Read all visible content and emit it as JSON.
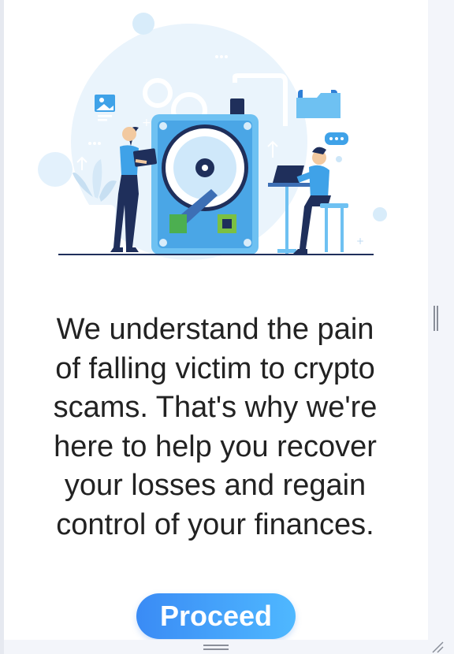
{
  "illustration": {
    "icon": "data-recovery-illustration"
  },
  "message": {
    "lines": [
      "We understand the pain",
      "of falling victim to crypto",
      "scams. That's why we're",
      "here to help you recover",
      "your losses and regain",
      "control of your finances."
    ]
  },
  "proceed_button": {
    "label": "Proceed"
  },
  "colors": {
    "accent": "#3a8bf5",
    "accent_light": "#4fb8ff",
    "text": "#222222",
    "illustration_blue": "#6ec1f2",
    "illustration_navy": "#1f2f5b"
  }
}
